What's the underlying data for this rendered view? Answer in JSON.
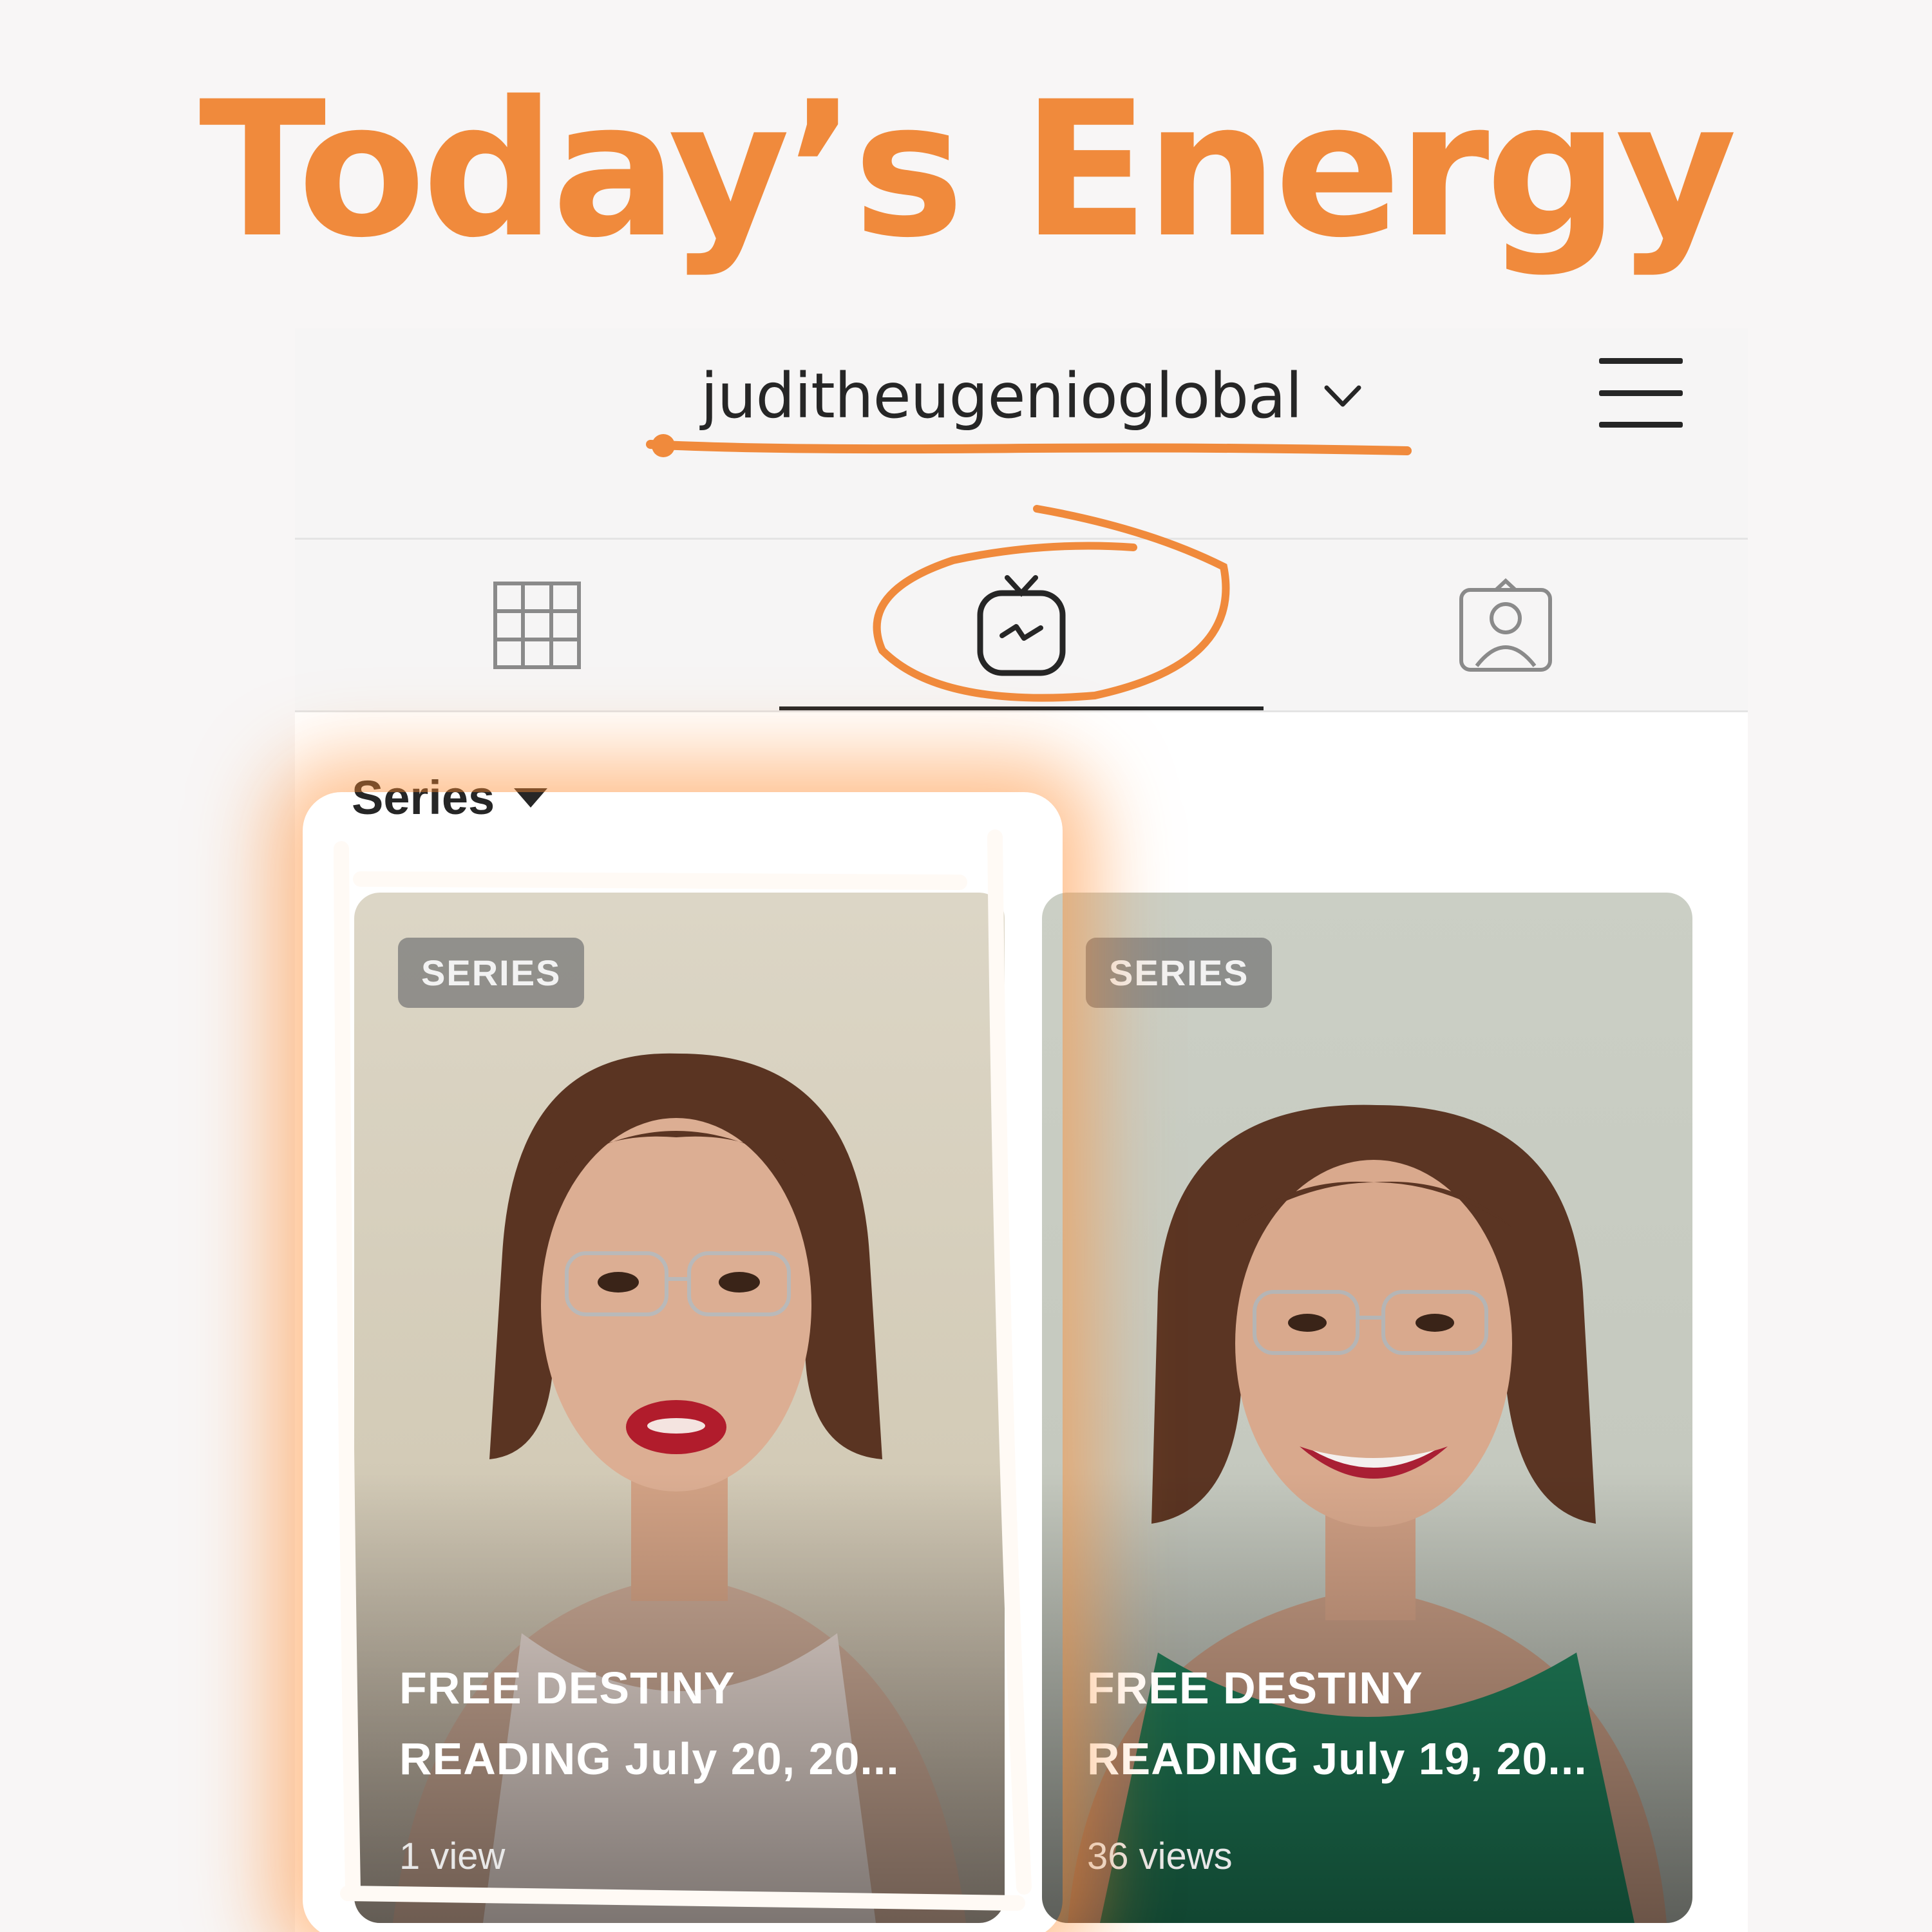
{
  "headline": "Today’s Energy",
  "header": {
    "username": "juditheugenioglobal"
  },
  "tabs": [
    {
      "icon": "grid-icon",
      "active": false
    },
    {
      "icon": "igtv-icon",
      "active": true
    },
    {
      "icon": "tagged-icon",
      "active": false
    }
  ],
  "filter": {
    "label": "Series"
  },
  "cards": [
    {
      "badge": "SERIES",
      "title_line1": "FREE DESTINY",
      "title_line2": "READING July 20, 20...",
      "views": "1 view"
    },
    {
      "badge": "SERIES",
      "title_line1": "FREE DESTINY",
      "title_line2": "READING July 19, 20...",
      "views": "36 views"
    }
  ],
  "colors": {
    "accent": "#f08a3c",
    "text": "#262626",
    "background": "#f8f6f6"
  }
}
